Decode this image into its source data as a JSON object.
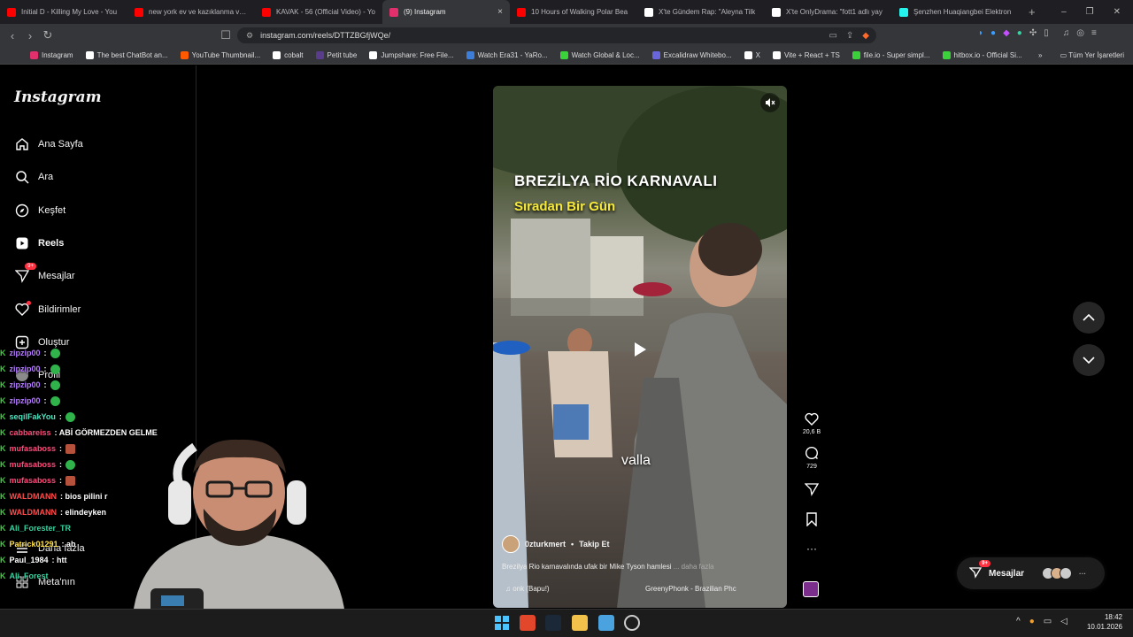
{
  "browser": {
    "tabs": [
      {
        "title": "Initial D - Killing My Love - You",
        "fav_color": "#ff0000",
        "active": false
      },
      {
        "title": "new york ev ve kazıklanma vlog",
        "fav_color": "#ff0000",
        "active": false
      },
      {
        "title": "KAVAK - 56 (Official Video) - Yo",
        "fav_color": "#ff0000",
        "active": false
      },
      {
        "title": "(9) Instagram",
        "fav_color": "#e1306c",
        "active": true
      },
      {
        "title": "10 Hours of Walking Polar Bea",
        "fav_color": "#ff0000",
        "active": false
      },
      {
        "title": "X'te Gündem Rap: \"Aleyna Tilk",
        "fav_color": "#ffffff",
        "active": false
      },
      {
        "title": "X'te OnlyDrama: \"fott1 adlı yay",
        "fav_color": "#ffffff",
        "active": false
      },
      {
        "title": "Şenzhen Huaqiangbei Elektron",
        "fav_color": "#25f4ee",
        "active": false
      }
    ],
    "url": "instagram.com/reels/DTTZBGfjWQe/",
    "bookmarks": [
      {
        "label": "Instagram",
        "color": "#e1306c"
      },
      {
        "label": "The best ChatBot an...",
        "color": "#ffffff"
      },
      {
        "label": "YouTube Thumbnail...",
        "color": "#ff5a00"
      },
      {
        "label": "cobalt",
        "color": "#ffffff"
      },
      {
        "label": "Petit tube",
        "color": "#5a3c8c"
      },
      {
        "label": "Jumpshare: Free File...",
        "color": "#ffffff"
      },
      {
        "label": "Watch Era31 - YaRo...",
        "color": "#3b7dd8"
      },
      {
        "label": "Watch Global & Loc...",
        "color": "#3bd13b"
      },
      {
        "label": "Excalidraw Whitebo...",
        "color": "#6965db"
      },
      {
        "label": "X",
        "color": "#ffffff"
      },
      {
        "label": "Vite + React + TS",
        "color": "#ffffff"
      },
      {
        "label": "file.io - Super simpl...",
        "color": "#3bd13b"
      },
      {
        "label": "hitbox.io - Official Si...",
        "color": "#3bd13b"
      }
    ],
    "bookmarks_more": "»",
    "all_bookmarks": "Tüm Yer İşaretleri",
    "ext_badge": "13"
  },
  "instagram": {
    "logo": "Instagram",
    "nav": [
      {
        "label": "Ana Sayfa",
        "icon": "home-icon"
      },
      {
        "label": "Ara",
        "icon": "search-icon"
      },
      {
        "label": "Keşfet",
        "icon": "compass-icon"
      },
      {
        "label": "Reels",
        "icon": "reels-icon"
      },
      {
        "label": "Mesajlar",
        "icon": "messenger-icon",
        "badge": "9+"
      },
      {
        "label": "Bildirimler",
        "icon": "heart-icon"
      },
      {
        "label": "Oluştur",
        "icon": "plus-icon"
      },
      {
        "label": "Profil",
        "icon": "avatar-icon"
      },
      {
        "label": "Daha fazla",
        "icon": "menu-icon"
      },
      {
        "label": "Meta'nın",
        "icon": "grid-icon"
      }
    ],
    "reel": {
      "title": "BREZİLYA RİO KARNAVALI",
      "subtitle": "Sıradan Bir Gün",
      "caption_word": "valla",
      "author": "0zturkmert",
      "follow": "Takip Et",
      "separator": "•",
      "description": "Brezilya Rio karnavalında ufak bir Mike Tyson hamlesi",
      "more": "... daha fazla",
      "audio_left": "onk (Bapu!)",
      "audio_right": "GreenyPhonk - Brazilian Phc"
    },
    "actions": {
      "likes": "20,6 B",
      "comments": "729"
    },
    "messages_pill": {
      "label": "Mesajlar",
      "badge": "9+"
    }
  },
  "chat": [
    {
      "user": "zipzip00",
      "color": "#b47cff",
      "msg": ":",
      "emote": "green"
    },
    {
      "user": "zipzip00",
      "color": "#b47cff",
      "msg": ":",
      "emote": "green"
    },
    {
      "user": "zipzip00",
      "color": "#b47cff",
      "msg": ":",
      "emote": "green"
    },
    {
      "user": "zipzip00",
      "color": "#b47cff",
      "msg": ":",
      "emote": "green"
    },
    {
      "user": "seqilFakYou",
      "color": "#4fe3c0",
      "msg": ":",
      "emote": "green"
    },
    {
      "user": "cabbareiss",
      "color": "#ff4a7a",
      "msg": ": ABİ GÖRMEZDEN GELME",
      "emote": ""
    },
    {
      "user": "mufasaboss",
      "color": "#ff4a7a",
      "msg": ":",
      "emote": "red"
    },
    {
      "user": "mufasaboss",
      "color": "#ff4a7a",
      "msg": ":",
      "emote": "green"
    },
    {
      "user": "mufasaboss",
      "color": "#ff4a7a",
      "msg": ":",
      "emote": "red"
    },
    {
      "user": "WALDMANN",
      "color": "#ff4a4a",
      "msg": ": bios pilini r",
      "emote": ""
    },
    {
      "user": "WALDMANN",
      "color": "#ff4a4a",
      "msg": ": elindeyken",
      "emote": ""
    },
    {
      "user": "Ali_Forester_TR",
      "color": "#3bd1a0",
      "msg": "",
      "emote": ""
    },
    {
      "user": "Patrick01291",
      "color": "#ffe14a",
      "msg": ": ab",
      "emote": ""
    },
    {
      "user": "Paul_1984",
      "color": "#ffffff",
      "msg": ": htt",
      "emote": ""
    },
    {
      "user": "Ali_Forest",
      "color": "#3bd1a0",
      "msg": "",
      "emote": ""
    }
  ],
  "taskbar": {
    "time": "18:42",
    "date": "10.01.2026"
  }
}
